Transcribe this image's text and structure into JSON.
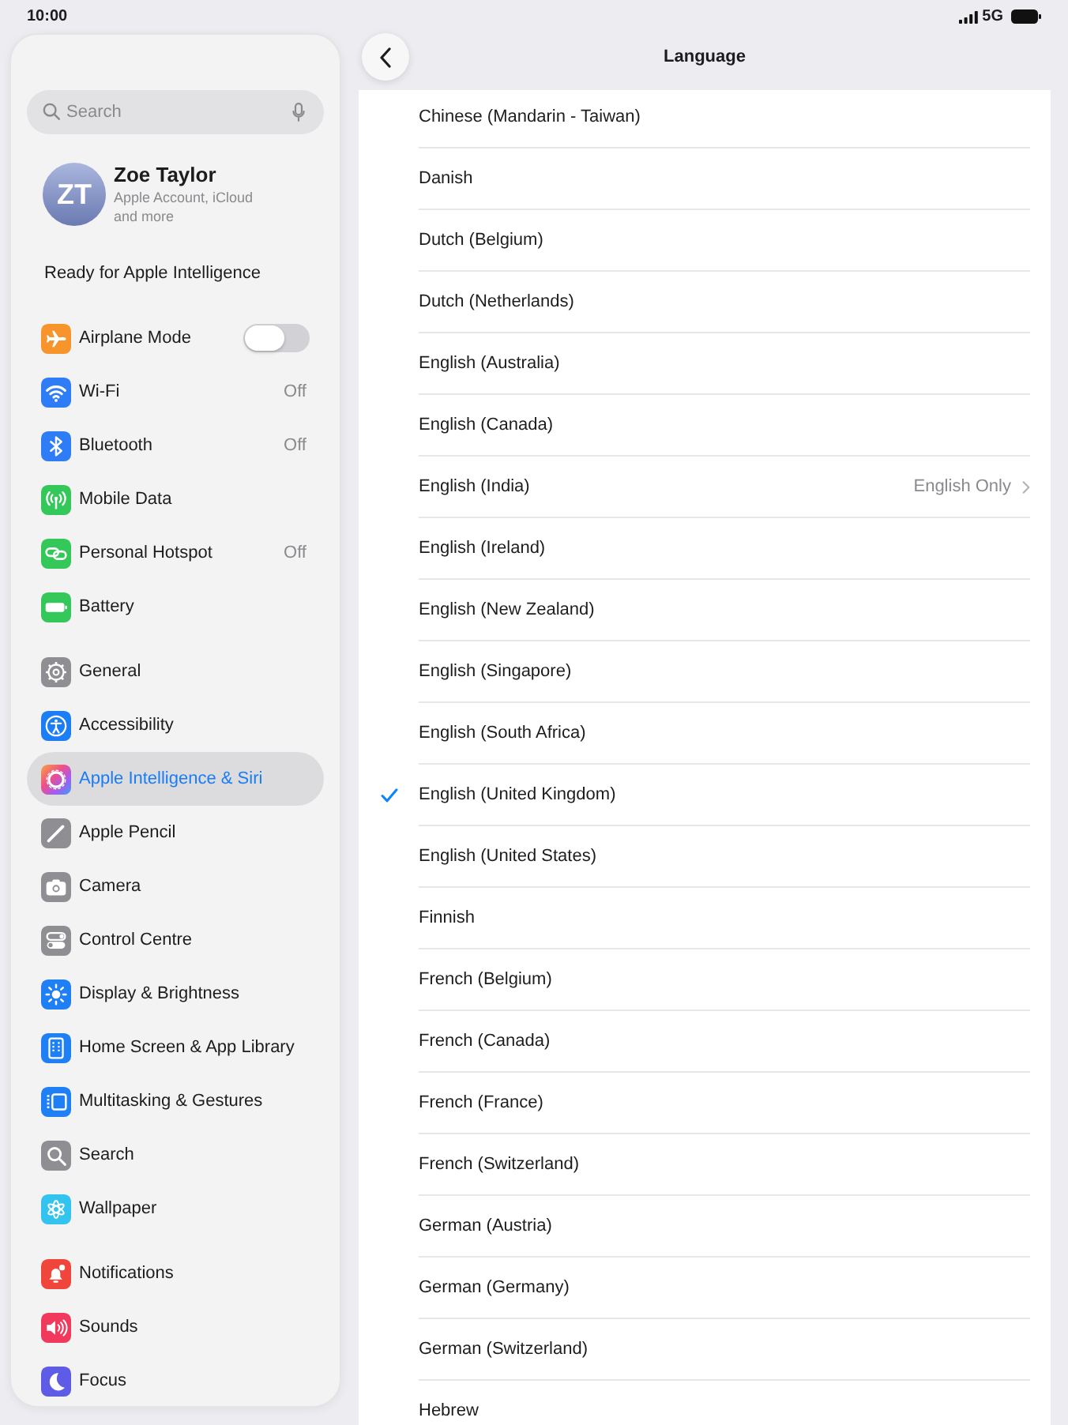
{
  "status_bar": {
    "time": "10:00",
    "network": "5G"
  },
  "sidebar": {
    "search": {
      "placeholder": "Search"
    },
    "account": {
      "initials": "ZT",
      "name": "Zoe Taylor",
      "subtitle": "Apple Account, iCloud and more"
    },
    "banner": "Ready for Apple Intelligence",
    "groups": [
      {
        "items": [
          {
            "kind": "toggle",
            "label": "Airplane Mode",
            "on": false,
            "selected": false
          },
          {
            "kind": "nav",
            "label": "Wi-Fi",
            "value": "Off",
            "selected": false
          },
          {
            "kind": "nav",
            "label": "Bluetooth",
            "value": "Off",
            "selected": false
          },
          {
            "kind": "nav",
            "label": "Mobile Data",
            "selected": false
          },
          {
            "kind": "nav",
            "label": "Personal Hotspot",
            "value": "Off",
            "selected": false
          },
          {
            "kind": "nav",
            "label": "Battery",
            "selected": false
          }
        ]
      },
      {
        "items": [
          {
            "kind": "nav",
            "label": "General",
            "selected": false
          },
          {
            "kind": "nav",
            "label": "Accessibility",
            "selected": false
          },
          {
            "kind": "nav",
            "label": "Apple Intelligence & Siri",
            "selected": true
          },
          {
            "kind": "nav",
            "label": "Apple Pencil",
            "selected": false
          },
          {
            "kind": "nav",
            "label": "Camera",
            "selected": false
          },
          {
            "kind": "nav",
            "label": "Control Centre",
            "selected": false
          },
          {
            "kind": "nav",
            "label": "Display & Brightness",
            "selected": false
          },
          {
            "kind": "nav",
            "label": "Home Screen & App Library",
            "selected": false
          },
          {
            "kind": "nav",
            "label": "Multitasking & Gestures",
            "selected": false
          },
          {
            "kind": "nav",
            "label": "Search",
            "selected": false
          },
          {
            "kind": "nav",
            "label": "Wallpaper",
            "selected": false
          }
        ]
      },
      {
        "items": [
          {
            "kind": "nav",
            "label": "Notifications",
            "selected": false
          },
          {
            "kind": "nav",
            "label": "Sounds",
            "selected": false
          },
          {
            "kind": "nav",
            "label": "Focus",
            "selected": false
          }
        ]
      }
    ]
  },
  "detail": {
    "title": "Language",
    "languages": [
      {
        "label": "Chinese (Mandarin - Taiwan)",
        "selected": false
      },
      {
        "label": "Danish",
        "selected": false
      },
      {
        "label": "Dutch (Belgium)",
        "selected": false
      },
      {
        "label": "Dutch (Netherlands)",
        "selected": false
      },
      {
        "label": "English (Australia)",
        "selected": false
      },
      {
        "label": "English (Canada)",
        "selected": false
      },
      {
        "label": "English (India)",
        "selected": false,
        "value": "English Only"
      },
      {
        "label": "English (Ireland)",
        "selected": false
      },
      {
        "label": "English (New Zealand)",
        "selected": false
      },
      {
        "label": "English (Singapore)",
        "selected": false
      },
      {
        "label": "English (South Africa)",
        "selected": false
      },
      {
        "label": "English (United Kingdom)",
        "selected": true
      },
      {
        "label": "English (United States)",
        "selected": false
      },
      {
        "label": "Finnish",
        "selected": false
      },
      {
        "label": "French (Belgium)",
        "selected": false
      },
      {
        "label": "French (Canada)",
        "selected": false
      },
      {
        "label": "French (France)",
        "selected": false
      },
      {
        "label": "French (Switzerland)",
        "selected": false
      },
      {
        "label": "German (Austria)",
        "selected": false
      },
      {
        "label": "German (Germany)",
        "selected": false
      },
      {
        "label": "German (Switzerland)",
        "selected": false
      },
      {
        "label": "Hebrew",
        "selected": false
      }
    ]
  }
}
